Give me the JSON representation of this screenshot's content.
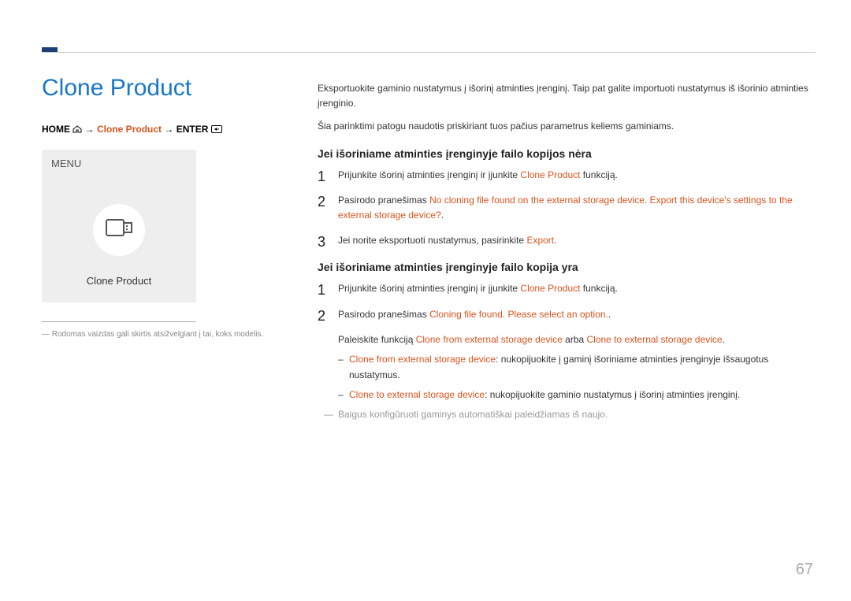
{
  "title": "Clone Product",
  "breadcrumb": {
    "home": "HOME",
    "mid": "Clone Product",
    "enter": "ENTER"
  },
  "preview": {
    "menu": "MENU",
    "label": "Clone Product"
  },
  "note": "― Rodomas vaizdas gali skirtis atsižvelgiant į tai, koks modelis.",
  "intro1": "Eksportuokite gaminio nustatymus į išorinį atminties įrenginį. Taip pat galite importuoti nustatymus iš išorinio atminties įrenginio.",
  "intro2": "Šia parinktimi patogu naudotis priskiriant tuos pačius parametrus keliems gaminiams.",
  "sec1": {
    "heading": "Jei išoriniame atminties įrenginyje failo kopijos nėra",
    "s1a": "Prijunkite išorinį atminties įrenginį ir įjunkite ",
    "s1hl": "Clone Product",
    "s1b": " funkciją.",
    "s2a": "Pasirodo pranešimas ",
    "s2hl": "No cloning file found on the external storage device. Export this device's settings to the external storage device?",
    "s2b": ".",
    "s3a": "Jei norite eksportuoti nustatymus, pasirinkite ",
    "s3hl": "Export",
    "s3b": "."
  },
  "sec2": {
    "heading": "Jei išoriniame atminties įrenginyje failo kopija yra",
    "s1a": "Prijunkite išorinį atminties įrenginį ir įjunkite ",
    "s1hl": "Clone Product",
    "s1b": " funkciją.",
    "s2a": "Pasirodo pranešimas ",
    "s2hl": "Cloning file found. Please select an option.",
    "s2b": ".",
    "run_a": "Paleiskite funkciją ",
    "run_hl1": "Clone from external storage device",
    "run_mid": " arba ",
    "run_hl2": "Clone to external storage device",
    "run_b": ".",
    "sub1_hl": "Clone from external storage device",
    "sub1_txt": ": nukopijuokite į gaminį išoriniame atminties įrenginyje išsaugotus nustatymus.",
    "sub2_hl": "Clone to external storage device",
    "sub2_txt": ": nukopijuokite gaminio nustatymus į išorinį atminties įrenginį.",
    "footnote": "Baigus konfigūruoti gaminys automatiškai paleidžiamas iš naujo."
  },
  "page": "67"
}
